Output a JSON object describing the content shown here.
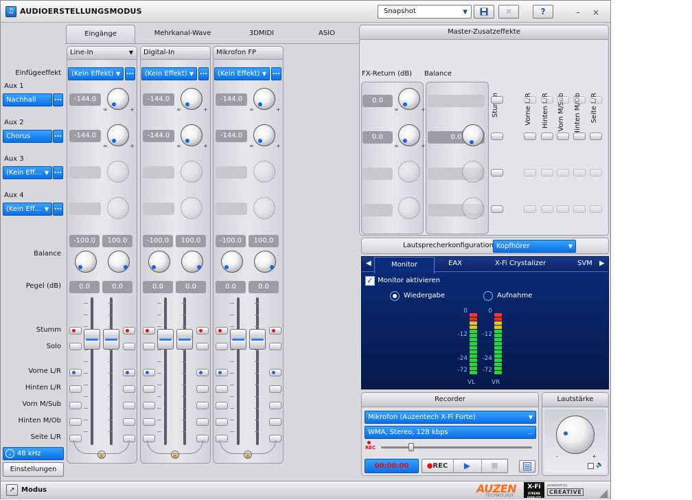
{
  "window": {
    "title": "AUDIOERSTELLUNGSMODUS",
    "snapshot_value": "Snapshot",
    "help_label": "?",
    "minimize": "–",
    "close": "×"
  },
  "tabs": [
    {
      "label": "Eingänge"
    },
    {
      "label": "Mehrkanal-Wave"
    },
    {
      "label": "3DMIDI"
    },
    {
      "label": "ASIO"
    }
  ],
  "left": {
    "einfuege_label": "Einfügeeffekt",
    "aux": [
      {
        "label": "Aux 1",
        "value": "Nachhall"
      },
      {
        "label": "Aux 2",
        "value": "Chorus"
      },
      {
        "label": "Aux 3",
        "value": "(Kein Eff..."
      },
      {
        "label": "Aux 4",
        "value": "(Kein Eff..."
      }
    ],
    "balance_label": "Balance",
    "pegel_label": "Pegel (dB)",
    "stumm_label": "Stumm",
    "solo_label": "Solo",
    "vorne_label": "Vorne L/R",
    "hinten_label": "Hinten L/R",
    "vornsub_label": "Vorn M/Sub",
    "hintenmob_label": "Hinten M/Ob",
    "seite_label": "Seite L/R",
    "sample_rate": "48 kHz",
    "settings_button": "Einstellungen",
    "dots": "..."
  },
  "strips": [
    {
      "name": "Line-In",
      "effect": "(Kein Effekt)",
      "aux1": "-144.0",
      "aux2": "-144.0",
      "bal_l": "-100.0",
      "bal_r": "100.0",
      "pegel_l": "0.0",
      "pegel_r": "0.0"
    },
    {
      "name": "Digital-In",
      "effect": "(Kein Effekt)",
      "aux1": "-144.0",
      "aux2": "-144.0",
      "bal_l": "-100.0",
      "bal_r": "100.0",
      "pegel_l": "0.0",
      "pegel_r": "0.0"
    },
    {
      "name": "Mikrofon FP",
      "effect": "(Kein Effekt)",
      "aux1": "-144.0",
      "aux2": "-144.0",
      "bal_l": "-100.0",
      "bal_r": "100.0",
      "pegel_l": "0.0",
      "pegel_r": "0.0"
    }
  ],
  "knob_marks": {
    "inf": "∞",
    "minus": "-",
    "plus": "+"
  },
  "master": {
    "title": "Master-Zusatzeffekte",
    "fx_return_label": "FX-Return (dB)",
    "balance_label": "Balance",
    "fx_values": [
      "0.0",
      "0.0"
    ],
    "balance_value": "0.0",
    "columns": [
      "Stumm",
      "Vorne L/R",
      "Hinten L/R",
      "Vorn M/Sub",
      "Hinten M/Ob",
      "Seite L/R"
    ]
  },
  "speaker": {
    "label": "Lautsprecherkonfiguration:",
    "value": "Kopfhörer"
  },
  "monitor_tabs": [
    "Monitor",
    "EAX",
    "X-Fi Crystalizer",
    "SVM"
  ],
  "monitor": {
    "enable_label": "Monitor aktivieren",
    "playback_label": "Wiedergabe",
    "record_label": "Aufnahme",
    "scale": [
      "0",
      "-12",
      "-24",
      "-72"
    ],
    "vl_label": "VL",
    "vr_label": "VR"
  },
  "recorder": {
    "title": "Recorder",
    "source": "Mikrofon (Auzentech X-Fi Forte)",
    "format": "WMA, Stereo, 128 kbps",
    "rec_small": "REC",
    "time": "00:00:00",
    "rec_button": "REC",
    "progress": 0.2
  },
  "volume": {
    "title": "Lautstärke",
    "minus": "-",
    "plus": "+"
  },
  "bottom": {
    "mode_label": "Modus",
    "brand1": "AUZEN",
    "brand1_sub": "TECHNOLOGY",
    "brand2": "X-Fi",
    "brand2_sub": "XTREME FIDELITY",
    "brand3_pre": "powered by",
    "brand3": "CREATIVE"
  },
  "colors": {
    "accent": "#0a6fe6",
    "monitor_bg": "#0a2c7a",
    "rec_red": "#e01010"
  }
}
